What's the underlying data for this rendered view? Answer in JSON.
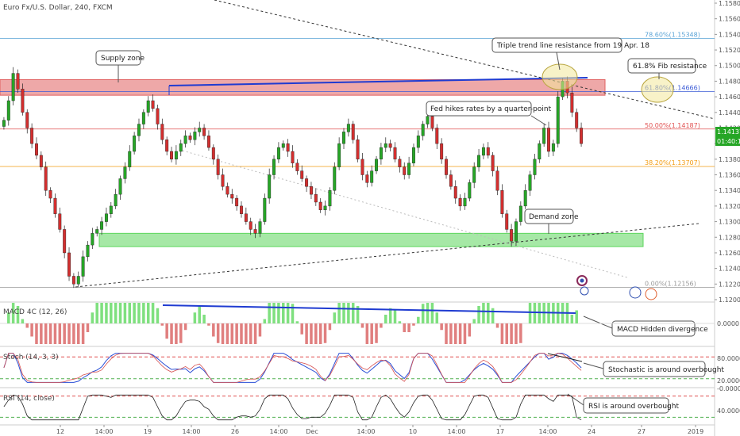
{
  "chart_data": {
    "type": "candlestick",
    "title": "Euro Fx/U.S. Dollar, 240, FXCM",
    "price_axis": {
      "ticks": [
        "1.15800",
        "1.15600",
        "1.15400",
        "1.15200",
        "1.15000",
        "1.14800",
        "1.14600",
        "1.14400",
        "1.14200",
        "1.14000",
        "1.13800",
        "1.13600",
        "1.13400",
        "1.13200",
        "1.13000",
        "1.12800",
        "1.12600",
        "1.12400",
        "1.12200",
        "1.12000"
      ],
      "range": [
        1.1195,
        1.1585
      ],
      "current_price": "1.14137",
      "countdown": "01:40:17"
    },
    "time_axis": {
      "ticks": [
        "12",
        "14:00",
        "19",
        "14:00",
        "26",
        "14:00",
        "Dec",
        "14:00",
        "10",
        "14:00",
        "17",
        "14:00",
        "24",
        "27",
        "2019"
      ]
    },
    "closes": [
      1.143,
      1.1455,
      1.149,
      1.147,
      1.144,
      1.142,
      1.14,
      1.1385,
      1.137,
      1.134,
      1.133,
      1.131,
      1.129,
      1.126,
      1.123,
      1.122,
      1.123,
      1.1255,
      1.127,
      1.1285,
      1.129,
      1.13,
      1.131,
      1.132,
      1.1335,
      1.1355,
      1.137,
      1.139,
      1.141,
      1.1425,
      1.144,
      1.1455,
      1.1445,
      1.1425,
      1.1405,
      1.139,
      1.138,
      1.139,
      1.14,
      1.141,
      1.1405,
      1.1415,
      1.142,
      1.141,
      1.1395,
      1.138,
      1.136,
      1.1345,
      1.1335,
      1.133,
      1.132,
      1.131,
      1.13,
      1.129,
      1.1285,
      1.13,
      1.133,
      1.136,
      1.138,
      1.1395,
      1.14,
      1.139,
      1.1375,
      1.1365,
      1.1355,
      1.1345,
      1.1335,
      1.1325,
      1.1315,
      1.132,
      1.134,
      1.137,
      1.14,
      1.1415,
      1.1425,
      1.1405,
      1.138,
      1.136,
      1.135,
      1.1365,
      1.138,
      1.1395,
      1.14,
      1.1395,
      1.138,
      1.137,
      1.136,
      1.1375,
      1.1395,
      1.141,
      1.1425,
      1.1435,
      1.142,
      1.14,
      1.138,
      1.136,
      1.1345,
      1.133,
      1.132,
      1.133,
      1.135,
      1.137,
      1.1385,
      1.1395,
      1.1385,
      1.1365,
      1.134,
      1.131,
      1.129,
      1.1275,
      1.13,
      1.132,
      1.134,
      1.136,
      1.138,
      1.14,
      1.142,
      1.139,
      1.14,
      1.146,
      1.148,
      1.1465,
      1.144,
      1.142,
      1.14
    ],
    "horizontal_levels": [
      {
        "label": "78.60%(1.15348)",
        "value": 1.15348,
        "color": "#5aa3d6"
      },
      {
        "label": "61.80%(1.14666)",
        "value": 1.14666,
        "color": "#3b5bd6"
      },
      {
        "label": "50.00%(1.14187)",
        "value": 1.14187,
        "color": "#e05050"
      },
      {
        "label": "38.20%(1.13707)",
        "value": 1.13707,
        "color": "#f39c12"
      },
      {
        "label": "0.00%(1.12156)",
        "value": 1.12156,
        "color": "#999999"
      }
    ],
    "zones": [
      {
        "name": "Supply zone",
        "from": 1.1462,
        "to": 1.1482,
        "color": "#e06060"
      },
      {
        "name": "Demand zone",
        "from": 1.1268,
        "to": 1.1285,
        "color": "#5cd65c"
      }
    ],
    "annotations": [
      {
        "text": "Supply zone"
      },
      {
        "text": "Triple trend line resistance from 19 Apr. 18"
      },
      {
        "text": "61.8% Fib resistance"
      },
      {
        "text": "Fed hikes rates by a quarter-point"
      },
      {
        "text": "Demand zone"
      },
      {
        "text": "MACD Hidden divergence"
      },
      {
        "text": "Stochastic is around overbought"
      },
      {
        "text": "RSI is around overbought"
      }
    ],
    "indicators": [
      {
        "name": "MACD 4C (12, 26)",
        "axis_label": "0.0000"
      },
      {
        "name": "Stoch (14, 3, 3)",
        "axis_labels": [
          "80.0000",
          "20.0000",
          "-0.0000"
        ]
      },
      {
        "name": "RSI (14, close)",
        "axis_labels": [
          "40.0000"
        ]
      }
    ],
    "colors": {
      "up": "#26a626",
      "down": "#d32f2f",
      "macd_up": "#7fe07f",
      "macd_down": "#e07f7f"
    }
  }
}
